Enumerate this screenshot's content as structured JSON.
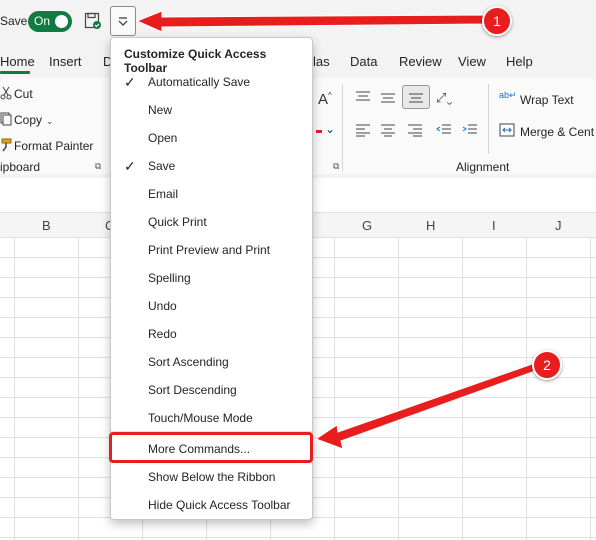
{
  "titlebar": {
    "autosave_label": "Save",
    "toggle_label": "On"
  },
  "tabs": [
    {
      "label": "Home",
      "selected": true
    },
    {
      "label": "Insert"
    },
    {
      "label": "D"
    },
    {
      "label": "las"
    },
    {
      "label": "Data"
    },
    {
      "label": "Review"
    },
    {
      "label": "View"
    },
    {
      "label": "Help"
    }
  ],
  "ribbon": {
    "clipboard": {
      "cut": "Cut",
      "copy": "Copy",
      "format_painter": "Format Painter",
      "group_label": "ipboard"
    },
    "alignment": {
      "wrap_text": "Wrap Text",
      "merge_center": "Merge & Cent",
      "group_label": "Alignment"
    }
  },
  "grid": {
    "columns": [
      "B",
      "C",
      "G",
      "H",
      "I",
      "J"
    ]
  },
  "menu": {
    "title": "Customize Quick Access Toolbar",
    "items": [
      {
        "label": "Automatically Save",
        "checked": true
      },
      {
        "label": "New",
        "checked": false
      },
      {
        "label": "Open",
        "checked": false
      },
      {
        "label": "Save",
        "checked": true
      },
      {
        "label": "Email",
        "checked": false
      },
      {
        "label": "Quick Print",
        "checked": false
      },
      {
        "label": "Print Preview and Print",
        "checked": false
      },
      {
        "label": "Spelling",
        "checked": false
      },
      {
        "label": "Undo",
        "checked": false
      },
      {
        "label": "Redo",
        "checked": false
      },
      {
        "label": "Sort Ascending",
        "checked": false
      },
      {
        "label": "Sort Descending",
        "checked": false
      },
      {
        "label": "Touch/Mouse Mode",
        "checked": false
      },
      {
        "label": "More Commands...",
        "highlighted": true
      },
      {
        "label": "Show Below the Ribbon"
      },
      {
        "label": "Hide Quick Access Toolbar"
      }
    ]
  },
  "annotations": {
    "callout_1": "1",
    "callout_2": "2",
    "accent_color": "#e81e1e"
  },
  "colors": {
    "excel_green": "#107c41"
  }
}
